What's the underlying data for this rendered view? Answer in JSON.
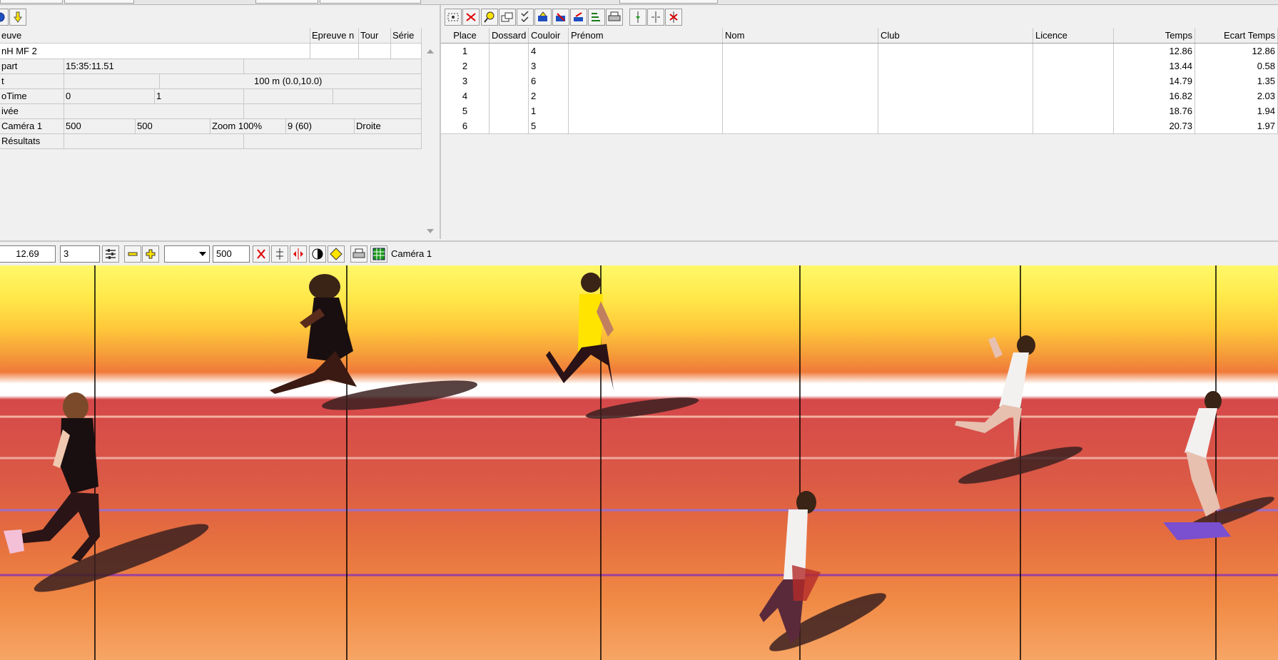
{
  "left_panel": {
    "rows": [
      {
        "cells": [
          "euve",
          "Epreuve n",
          "Tour",
          "Série"
        ]
      },
      {
        "cells": [
          "nH MF 2",
          "",
          "",
          ""
        ]
      },
      {
        "cells": [
          "part",
          "15:35:11.51",
          ""
        ]
      },
      {
        "cells": [
          "t",
          "",
          "100 m (0.0,10.0)"
        ]
      },
      {
        "cells": [
          "oTime",
          "0",
          "1",
          "",
          ""
        ]
      },
      {
        "cells": [
          "ivée",
          "",
          ""
        ]
      },
      {
        "cells": [
          "Caméra 1",
          "500",
          "500",
          "Zoom 100%",
          "9  (60)",
          "Droite"
        ]
      },
      {
        "cells": [
          "Résultats",
          "",
          ""
        ]
      }
    ]
  },
  "results": {
    "columns": [
      "Place",
      "Dossard",
      "Couloir",
      "Prénom",
      "Nom",
      "Club",
      "Licence",
      "Temps",
      "Ecart Temps"
    ],
    "rows": [
      {
        "place": "1",
        "dossard": "",
        "couloir": "4",
        "prenom": "",
        "nom": "",
        "club": "",
        "licence": "",
        "temps": "12.86",
        "ecart": "12.86"
      },
      {
        "place": "2",
        "dossard": "",
        "couloir": "3",
        "prenom": "",
        "nom": "",
        "club": "",
        "licence": "",
        "temps": "13.44",
        "ecart": "0.58"
      },
      {
        "place": "3",
        "dossard": "",
        "couloir": "6",
        "prenom": "",
        "nom": "",
        "club": "",
        "licence": "",
        "temps": "14.79",
        "ecart": "1.35"
      },
      {
        "place": "4",
        "dossard": "",
        "couloir": "2",
        "prenom": "",
        "nom": "",
        "club": "",
        "licence": "",
        "temps": "16.82",
        "ecart": "2.03"
      },
      {
        "place": "5",
        "dossard": "",
        "couloir": "1",
        "prenom": "",
        "nom": "",
        "club": "",
        "licence": "",
        "temps": "18.76",
        "ecart": "1.94"
      },
      {
        "place": "6",
        "dossard": "",
        "couloir": "5",
        "prenom": "",
        "nom": "",
        "club": "",
        "licence": "",
        "temps": "20.73",
        "ecart": "1.97"
      }
    ]
  },
  "mid_toolbar": {
    "time_value": "12.69",
    "step_value": "3",
    "zoom_value": "500",
    "camera_label": "Caméra 1",
    "dropdown_value": ""
  },
  "icons": {
    "left_toolbar": [
      "blue-circle-icon",
      "down-arrow-icon"
    ],
    "right_toolbar": [
      "select-area-icon",
      "delete-icon",
      "zoom-icon",
      "windows-icon",
      "checklist-icon",
      "export-icon",
      "import-icon",
      "send-icon",
      "ranking-icon",
      "print-icon",
      "add-marker-icon",
      "split-icon",
      "remove-marker-icon"
    ],
    "mid_toolbar": [
      "settings-icon",
      "zoom-out-icon",
      "zoom-in-icon",
      "clear-icon",
      "adjust-icon",
      "flip-icon",
      "contrast-icon",
      "brightness-icon",
      "print-icon",
      "grid-icon"
    ]
  },
  "colors": {
    "track_red": "#d9534a",
    "track_orange": "#f28a40",
    "track_yellow": "#fff25a",
    "toolbar_bg": "#f0f0f0"
  }
}
